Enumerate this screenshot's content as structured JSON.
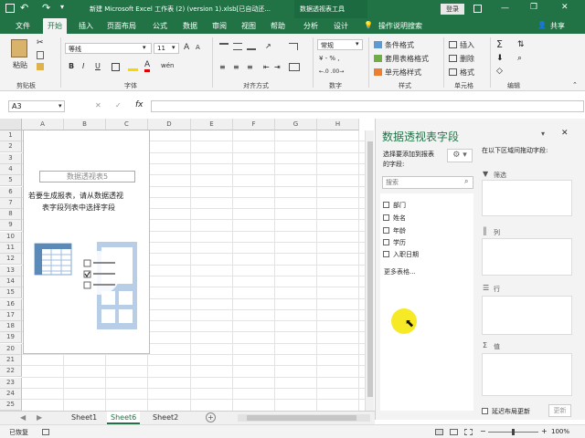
{
  "titlebar": {
    "title": "新建 Microsoft Excel 工作表 (2) (version 1).xlsb[已自动还...",
    "context_tool": "数据透视表工具",
    "login": "登录",
    "minimize": "—",
    "restore": "❐",
    "close": "✕"
  },
  "tabs": [
    "文件",
    "开始",
    "插入",
    "页面布局",
    "公式",
    "数据",
    "审阅",
    "视图",
    "帮助",
    "分析",
    "设计"
  ],
  "tell_me": "操作说明搜索",
  "share": "共享",
  "ribbon": {
    "paste": "粘贴",
    "font_name": "等线",
    "font_size": "11",
    "grow": "A",
    "shrink": "A",
    "bold": "B",
    "italic": "I",
    "underline": "U",
    "wen": "wén",
    "number_format": "常规",
    "currency": "¥ - % ,",
    "decimals": "←.0 .00→",
    "cond_format": "条件格式",
    "table_format": "套用表格格式",
    "cell_style": "单元格样式",
    "insert": "插入",
    "delete": "删除",
    "format": "格式",
    "sigma": "Σ",
    "groups": {
      "clipboard": "剪贴板",
      "font": "字体",
      "alignment": "对齐方式",
      "number": "数字",
      "styles": "样式",
      "cells": "单元格",
      "editing": "编辑"
    }
  },
  "formula_bar": {
    "name_box": "A3",
    "cancel": "✕",
    "enter": "✓",
    "fx": "fx",
    "value": ""
  },
  "columns": [
    "A",
    "B",
    "C",
    "D",
    "E",
    "F",
    "G",
    "H"
  ],
  "rows": [
    "1",
    "2",
    "3",
    "4",
    "5",
    "6",
    "7",
    "8",
    "9",
    "10",
    "11",
    "12",
    "13",
    "14",
    "15",
    "16",
    "17",
    "18",
    "19",
    "20",
    "21",
    "22",
    "23",
    "24",
    "25"
  ],
  "pivot_placeholder": {
    "title": "数据透视表5",
    "instruction_line1": "若要生成报表，请从数据透视",
    "instruction_line2": "表字段列表中选择字段"
  },
  "pivot_pane": {
    "title": "数据透视表字段",
    "choose_label_line1": "选择要添加到报表",
    "choose_label_line2": "的字段:",
    "drag_label": "在以下区域间拖动字段:",
    "search_placeholder": "搜索",
    "fields": [
      "部门",
      "姓名",
      "年龄",
      "学历",
      "入职日期"
    ],
    "more_tables": "更多表格...",
    "areas": {
      "filter": "筛选",
      "columns": "列",
      "rows": "行",
      "values": "值"
    },
    "defer_update": "延迟布局更新",
    "update_button": "更新"
  },
  "sheets": [
    "Sheet1",
    "Sheet6",
    "Sheet2"
  ],
  "active_sheet": "Sheet6",
  "add_sheet": "+",
  "status": {
    "ready": "已恢复",
    "zoom": "100%",
    "minus": "−",
    "plus": "+"
  },
  "colors": {
    "excel_green": "#217346",
    "ribbon_bg": "#f3f3f3",
    "cursor_highlight": "#f5e600"
  }
}
